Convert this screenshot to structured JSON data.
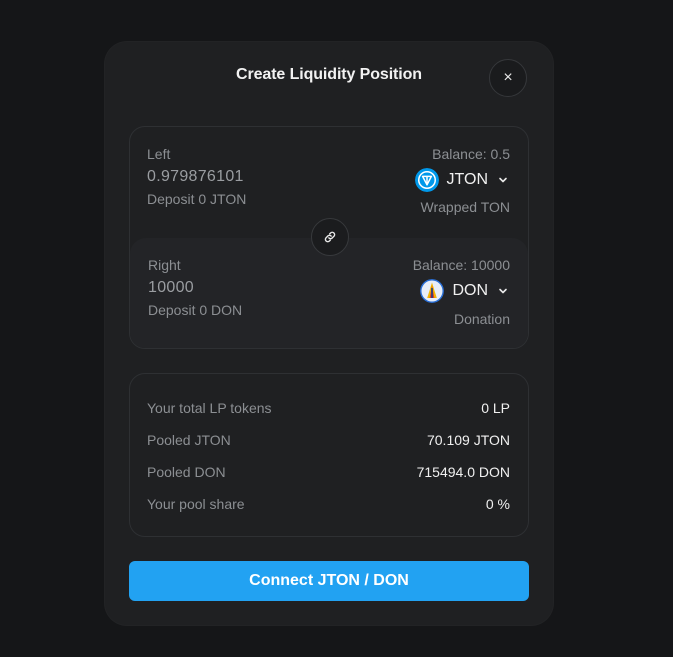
{
  "modal": {
    "title": "Create Liquidity Position",
    "close_glyph": "×"
  },
  "left": {
    "label": "Left",
    "amount": "0.979876101",
    "deposit": "Deposit 0 JTON",
    "balance": "Balance: 0.5",
    "token": "JTON",
    "token_icon": "ton-icon",
    "token_desc": "Wrapped TON"
  },
  "right": {
    "label": "Right",
    "amount": "10000",
    "deposit": "Deposit 0 DON",
    "balance": "Balance: 10000",
    "token": "DON",
    "token_icon": "don-icon",
    "token_desc": "Donation"
  },
  "link_icon": "link-icon",
  "pool_info": {
    "rows": [
      {
        "label": "Your total LP tokens",
        "value": "0 LP"
      },
      {
        "label": "Pooled JTON",
        "value": "70.109 JTON"
      },
      {
        "label": "Pooled DON",
        "value": "715494.0 DON"
      },
      {
        "label": "Your pool share",
        "value": "0 %"
      }
    ]
  },
  "connect_button": "Connect JTON / DON",
  "colors": {
    "background": "#151618",
    "modal": "#1f2022",
    "accent": "#22a2f2",
    "muted_text": "#8c8f93"
  }
}
